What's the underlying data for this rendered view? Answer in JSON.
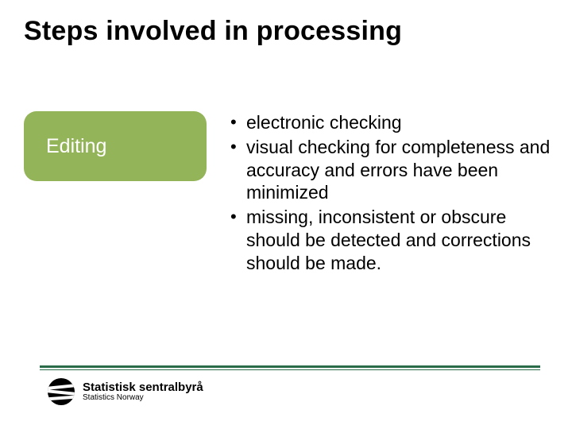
{
  "title": "Steps involved in processing",
  "step": {
    "label": "Editing"
  },
  "bullets": [
    "electronic checking",
    "visual checking for completeness and accuracy and errors have been minimized",
    "missing, inconsistent or obscure should be detected and corrections should be made."
  ],
  "footer": {
    "org_main": "Statistisk sentralbyrå",
    "org_sub": "Statistics Norway"
  },
  "colors": {
    "pill_bg": "#94b459",
    "rule": "#2a6b49"
  }
}
